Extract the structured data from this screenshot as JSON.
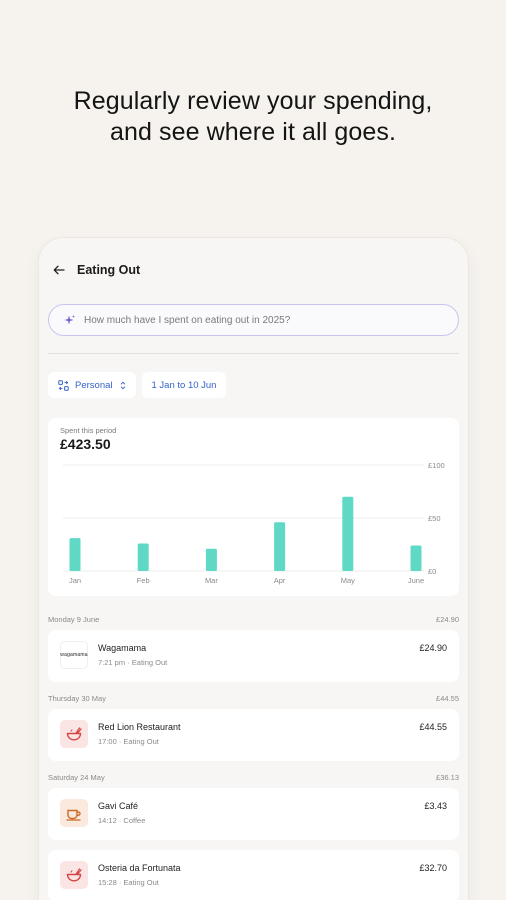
{
  "headline": {
    "line1": "Regularly review your spending,",
    "line2": "and see where it all goes."
  },
  "screen": {
    "title": "Eating Out",
    "search": {
      "placeholder": "How much have I spent on eating out in 2025?",
      "icon": "sparkle-icon"
    },
    "filters": {
      "account": "Personal",
      "date_range": "1 Jan to 10 Jun"
    },
    "summary": {
      "label": "Spent this period",
      "amount": "£423.50"
    },
    "chart_data": {
      "type": "bar",
      "categories": [
        "Jan",
        "Feb",
        "Mar",
        "Apr",
        "May",
        "June"
      ],
      "values": [
        31,
        26,
        21,
        46,
        70,
        24
      ],
      "ylim": [
        0,
        100
      ],
      "y_ticks": [
        "£100",
        "£50",
        "£0"
      ],
      "grid": true,
      "bar_color": "#5fd8c6"
    },
    "groups": [
      {
        "date": "Monday 9 June",
        "total": "£24.90",
        "items": [
          {
            "name": "Wagamama",
            "meta": "7:21 pm · Eating Out",
            "amount": "£24.90",
            "logo": "wagamama",
            "logo_text": "wagamama"
          }
        ]
      },
      {
        "date": "Thursday 30 May",
        "total": "£44.55",
        "items": [
          {
            "name": "Red Lion Restaurant",
            "meta": "17:00 · Eating Out",
            "amount": "£44.55",
            "logo": "bowl-icon"
          }
        ]
      },
      {
        "date": "Saturday 24 May",
        "total": "£36.13",
        "items": [
          {
            "name": "Gavi Café",
            "meta": "14:12 · Coffee",
            "amount": "£3.43",
            "logo": "coffee-cup-icon"
          },
          {
            "name": "Osteria da Fortunata",
            "meta": "15:28 · Eating Out",
            "amount": "£32.70",
            "logo": "bowl-icon"
          }
        ]
      }
    ],
    "colors": {
      "background": "#f6f3ee",
      "accent_blue": "#3563c9",
      "search_border": "#c9c6ee",
      "bar": "#5fd8c6",
      "eating_out_icon": "#d64545",
      "coffee_icon": "#c86a2a"
    }
  }
}
